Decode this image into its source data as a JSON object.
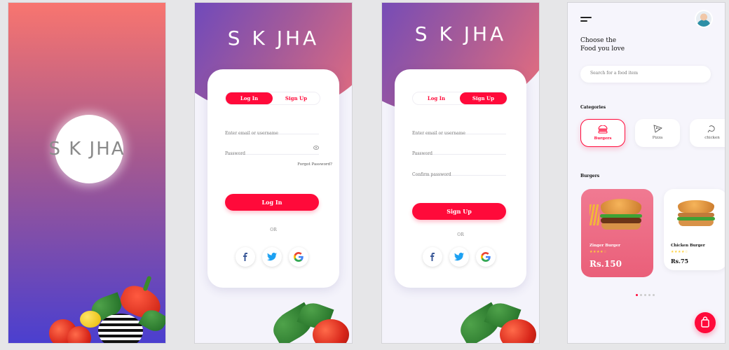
{
  "splash": {
    "brand": "S K JHA"
  },
  "login": {
    "brand": "S K JHA",
    "tabs": [
      "Log In",
      "Sign Up"
    ],
    "email_placeholder": "Enter email or username",
    "password_placeholder": "Password",
    "forgot_label": "Forgot Password?",
    "submit_label": "Log In",
    "or_label": "OR"
  },
  "signup": {
    "brand": "S K JHA",
    "tabs": [
      "Log In",
      "Sign Up"
    ],
    "email_placeholder": "Enter email or username",
    "password_placeholder": "Password",
    "confirm_placeholder": "Confirm password",
    "submit_label": "Sign Up",
    "or_label": "OR"
  },
  "home": {
    "headline_line1": "Choose the",
    "headline_line2": "Food you love",
    "search_placeholder": "Search for a food item",
    "categories_title": "Categories",
    "categories": [
      {
        "label": "Burgers",
        "icon": "burger-icon"
      },
      {
        "label": "Pizza",
        "icon": "pizza-icon"
      },
      {
        "label": "chicken",
        "icon": "chicken-icon"
      }
    ],
    "section_title": "Burgers",
    "foods": [
      {
        "name": "Zinger Burger",
        "price": "Rs.150",
        "stars": "★★★★☆"
      },
      {
        "name": "Chicken Burger",
        "price": "Rs.75",
        "stars": "★★★★☆"
      }
    ],
    "colors": {
      "accent": "#ff0a3a",
      "card": "#ec6681"
    }
  }
}
